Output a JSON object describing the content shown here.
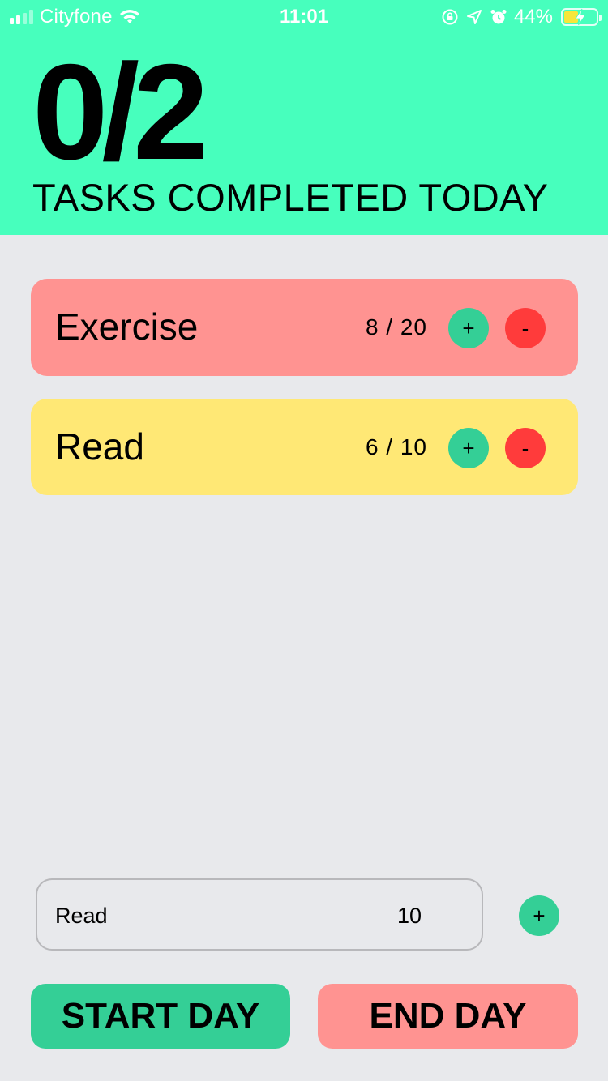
{
  "status_bar": {
    "carrier": "Cityfone",
    "time": "11:01",
    "battery": "44%",
    "battery_level": 0.44
  },
  "header": {
    "completed": "0/2",
    "subtitle": "TASKS COMPLETED TODAY",
    "accent_color": "#47ffbd"
  },
  "tasks": [
    {
      "name": "Exercise",
      "count": "8 / 20",
      "plus_label": "+",
      "minus_label": "-",
      "color": "#ff9391"
    },
    {
      "name": "Read",
      "count": "6 / 10",
      "plus_label": "+",
      "minus_label": "-",
      "color": "#ffe875"
    }
  ],
  "add_task": {
    "name_value": "Read",
    "goal_value": "10",
    "add_label": "+"
  },
  "actions": {
    "start_label": "START DAY",
    "end_label": "END DAY"
  }
}
